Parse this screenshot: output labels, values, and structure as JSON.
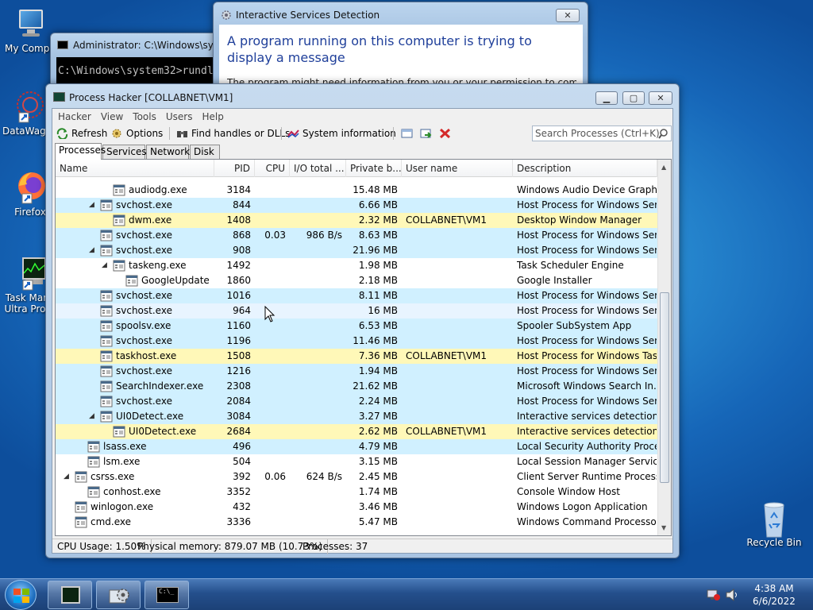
{
  "desktop": {
    "icons": [
      {
        "label": "My Compu",
        "icon": "computer-icon"
      },
      {
        "label": "DataWago",
        "icon": "datawagon-icon"
      },
      {
        "label": "Firefox",
        "icon": "firefox-icon"
      },
      {
        "label": "Task Mana",
        "label2": "Ultra Pro D",
        "icon": "task-manager-icon"
      },
      {
        "label": "Recycle Bin",
        "icon": "recycle-bin-icon"
      }
    ]
  },
  "cmd_window": {
    "title": "Administrator: C:\\Windows\\syste",
    "line": "C:\\Windows\\system32>rundl"
  },
  "uidetect_window": {
    "title": "Interactive Services Detection",
    "heading": "A program running on this computer is trying to display a message",
    "body": "The program might need information from you or your permission to complete a"
  },
  "process_hacker": {
    "title": "Process Hacker [COLLABNET\\VM1]",
    "menu": [
      "Hacker",
      "View",
      "Tools",
      "Users",
      "Help"
    ],
    "toolbar": {
      "refresh": "Refresh",
      "options": "Options",
      "find_handles": "Find handles or DLLs",
      "system_information": "System information"
    },
    "search_placeholder": "Search Processes (Ctrl+K)",
    "tabs": [
      "Processes",
      "Services",
      "Network",
      "Disk"
    ],
    "columns": [
      "Name",
      "PID",
      "CPU",
      "I/O total ...",
      "Private b...",
      "User name",
      "Description"
    ],
    "rows": [
      {
        "name": "audiodg.exe",
        "pid": "3184",
        "cpu": "",
        "io": "",
        "priv": "15.48 MB",
        "user": "",
        "desc": "Windows Audio Device Graph...",
        "indent": 4,
        "exp": "",
        "bg": "none"
      },
      {
        "name": "svchost.exe",
        "pid": "844",
        "cpu": "",
        "io": "",
        "priv": "6.66 MB",
        "user": "",
        "desc": "Host Process for Windows Ser...",
        "indent": 3,
        "exp": "◢",
        "bg": "svc"
      },
      {
        "name": "dwm.exe",
        "pid": "1408",
        "cpu": "",
        "io": "",
        "priv": "2.32 MB",
        "user": "COLLABNET\\VM1",
        "desc": "Desktop Window Manager",
        "indent": 4,
        "exp": "",
        "bg": "own"
      },
      {
        "name": "svchost.exe",
        "pid": "868",
        "cpu": "0.03",
        "io": "986 B/s",
        "priv": "8.63 MB",
        "user": "",
        "desc": "Host Process for Windows Ser...",
        "indent": 3,
        "exp": "",
        "bg": "svc"
      },
      {
        "name": "svchost.exe",
        "pid": "908",
        "cpu": "",
        "io": "",
        "priv": "21.96 MB",
        "user": "",
        "desc": "Host Process for Windows Ser...",
        "indent": 3,
        "exp": "◢",
        "bg": "svc"
      },
      {
        "name": "taskeng.exe",
        "pid": "1492",
        "cpu": "",
        "io": "",
        "priv": "1.98 MB",
        "user": "",
        "desc": "Task Scheduler Engine",
        "indent": 4,
        "exp": "◢",
        "bg": "none"
      },
      {
        "name": "GoogleUpdate....",
        "pid": "1860",
        "cpu": "",
        "io": "",
        "priv": "2.18 MB",
        "user": "",
        "desc": "Google Installer",
        "indent": 5,
        "exp": "",
        "bg": "none"
      },
      {
        "name": "svchost.exe",
        "pid": "1016",
        "cpu": "",
        "io": "",
        "priv": "8.11 MB",
        "user": "",
        "desc": "Host Process for Windows Ser...",
        "indent": 3,
        "exp": "",
        "bg": "svc"
      },
      {
        "name": "svchost.exe",
        "pid": "964",
        "cpu": "",
        "io": "",
        "priv": "16 MB",
        "user": "",
        "desc": "Host Process for Windows Ser...",
        "indent": 3,
        "exp": "",
        "bg": "sel"
      },
      {
        "name": "spoolsv.exe",
        "pid": "1160",
        "cpu": "",
        "io": "",
        "priv": "6.53 MB",
        "user": "",
        "desc": "Spooler SubSystem App",
        "indent": 3,
        "exp": "",
        "bg": "svc"
      },
      {
        "name": "svchost.exe",
        "pid": "1196",
        "cpu": "",
        "io": "",
        "priv": "11.46 MB",
        "user": "",
        "desc": "Host Process for Windows Ser...",
        "indent": 3,
        "exp": "",
        "bg": "svc"
      },
      {
        "name": "taskhost.exe",
        "pid": "1508",
        "cpu": "",
        "io": "",
        "priv": "7.36 MB",
        "user": "COLLABNET\\VM1",
        "desc": "Host Process for Windows Tas...",
        "indent": 3,
        "exp": "",
        "bg": "own"
      },
      {
        "name": "svchost.exe",
        "pid": "1216",
        "cpu": "",
        "io": "",
        "priv": "1.94 MB",
        "user": "",
        "desc": "Host Process for Windows Ser...",
        "indent": 3,
        "exp": "",
        "bg": "svc"
      },
      {
        "name": "SearchIndexer.exe",
        "pid": "2308",
        "cpu": "",
        "io": "",
        "priv": "21.62 MB",
        "user": "",
        "desc": "Microsoft Windows Search In...",
        "indent": 3,
        "exp": "",
        "bg": "svc"
      },
      {
        "name": "svchost.exe",
        "pid": "2084",
        "cpu": "",
        "io": "",
        "priv": "2.24 MB",
        "user": "",
        "desc": "Host Process for Windows Ser...",
        "indent": 3,
        "exp": "",
        "bg": "svc"
      },
      {
        "name": "UI0Detect.exe",
        "pid": "3084",
        "cpu": "",
        "io": "",
        "priv": "3.27 MB",
        "user": "",
        "desc": "Interactive services detection",
        "indent": 3,
        "exp": "◢",
        "bg": "svc"
      },
      {
        "name": "UI0Detect.exe",
        "pid": "2684",
        "cpu": "",
        "io": "",
        "priv": "2.62 MB",
        "user": "COLLABNET\\VM1",
        "desc": "Interactive services detection",
        "indent": 4,
        "exp": "",
        "bg": "own"
      },
      {
        "name": "lsass.exe",
        "pid": "496",
        "cpu": "",
        "io": "",
        "priv": "4.79 MB",
        "user": "",
        "desc": "Local Security Authority Proce...",
        "indent": 2,
        "exp": "",
        "bg": "svc"
      },
      {
        "name": "lsm.exe",
        "pid": "504",
        "cpu": "",
        "io": "",
        "priv": "3.15 MB",
        "user": "",
        "desc": "Local Session Manager Service",
        "indent": 2,
        "exp": "",
        "bg": "none"
      },
      {
        "name": "csrss.exe",
        "pid": "392",
        "cpu": "0.06",
        "io": "624 B/s",
        "priv": "2.45 MB",
        "user": "",
        "desc": "Client Server Runtime Process",
        "indent": 1,
        "exp": "◢",
        "bg": "none"
      },
      {
        "name": "conhost.exe",
        "pid": "3352",
        "cpu": "",
        "io": "",
        "priv": "1.74 MB",
        "user": "",
        "desc": "Console Window Host",
        "indent": 2,
        "exp": "",
        "bg": "none"
      },
      {
        "name": "winlogon.exe",
        "pid": "432",
        "cpu": "",
        "io": "",
        "priv": "3.46 MB",
        "user": "",
        "desc": "Windows Logon Application",
        "indent": 1,
        "exp": "",
        "bg": "none"
      },
      {
        "name": "cmd.exe",
        "pid": "3336",
        "cpu": "",
        "io": "",
        "priv": "5.47 MB",
        "user": "",
        "desc": "Windows Command Processor",
        "indent": 1,
        "exp": "",
        "bg": "none"
      }
    ],
    "status": {
      "cpu": "CPU Usage: 1.50%",
      "mem": "Physical memory: 879.07 MB (10.73%)",
      "procs": "Processes: 37"
    }
  },
  "taskbar": {
    "time": "4:38 AM",
    "date": "6/6/2022"
  },
  "colors": {
    "service_row": "#d0f0ff",
    "own_process_row": "#fff8b8"
  }
}
